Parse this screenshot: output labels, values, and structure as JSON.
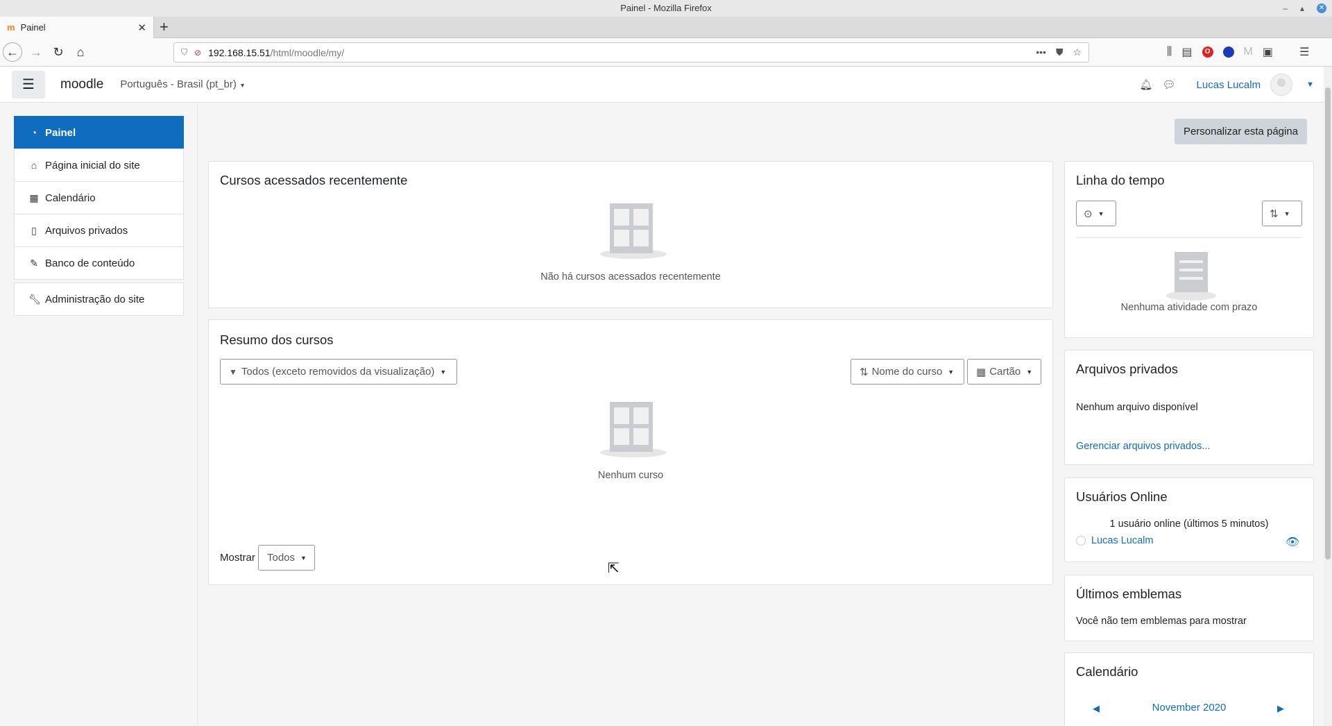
{
  "window": {
    "title": "Painel - Mozilla Firefox"
  },
  "tab": {
    "label": "Painel"
  },
  "urlbar": {
    "host": "192.168.15.51",
    "path": "/html/moodle/my/"
  },
  "header": {
    "brand": "moodle",
    "language": "Português - Brasil (pt_br)",
    "user_name": "Lucas Lucalm"
  },
  "nav": {
    "items": [
      {
        "label": "Painel",
        "icon": "dashboard-icon",
        "active": true
      },
      {
        "label": "Página inicial do site",
        "icon": "home-icon"
      },
      {
        "label": "Calendário",
        "icon": "calendar-icon"
      },
      {
        "label": "Arquivos privados",
        "icon": "file-icon"
      },
      {
        "label": "Banco de conteúdo",
        "icon": "brush-icon"
      },
      {
        "label": "Administração do site",
        "icon": "wrench-icon"
      }
    ]
  },
  "page": {
    "customize_button": "Personalizar esta página"
  },
  "recent_courses": {
    "title": "Cursos acessados recentemente",
    "empty_text": "Não há cursos acessados recentemente"
  },
  "course_overview": {
    "title": "Resumo dos cursos",
    "filter": "Todos (exceto removidos da visualização)",
    "sort": "Nome do curso",
    "view": "Cartão",
    "empty_text": "Nenhum curso",
    "show_label": "Mostrar",
    "show_value": "Todos"
  },
  "timeline": {
    "title": "Linha do tempo",
    "empty_text": "Nenhuma atividade com prazo"
  },
  "private_files": {
    "title": "Arquivos privados",
    "empty_text": "Nenhum arquivo disponível",
    "manage_link": "Gerenciar arquivos privados..."
  },
  "online_users": {
    "title": "Usuários Online",
    "summary": "1 usuário online (últimos 5 minutos)",
    "users": [
      "Lucas Lucalm"
    ]
  },
  "badges": {
    "title": "Últimos emblemas",
    "empty_text": "Você não tem emblemas para mostrar"
  },
  "calendar": {
    "title": "Calendário",
    "month": "November 2020"
  },
  "colors": {
    "brand_blue": "#0f6cbf",
    "active_nav": "#0f6cbf",
    "button_gray": "#ced4da"
  }
}
